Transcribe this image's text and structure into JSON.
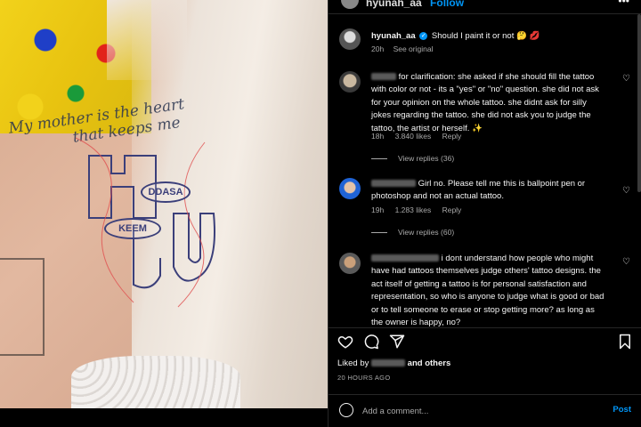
{
  "header": {
    "username": "hyunah_aa",
    "follow_label": "Follow"
  },
  "caption": {
    "username": "hyunah_aa",
    "text": "Should I paint it or not 🤔 💋",
    "time": "20h",
    "see_original": "See original"
  },
  "photo": {
    "tattoo_script_line1": "My mother is the heart",
    "tattoo_script_line2": "that keeps me",
    "oval_1": "DDASA",
    "oval_2": "KEEM"
  },
  "comments": [
    {
      "lines": [
        "for clarification: she asked if she should fill the tattoo",
        "with color or not - its a \"yes\" or \"no\" question. she did not ask",
        "for your opinion on the whole tattoo. she didnt ask for silly",
        "jokes regarding the tattoo. she did not ask you to judge the",
        "tattoo, the artist or herself. ✨"
      ],
      "time": "18h",
      "likes": "3.840 likes",
      "reply": "Reply",
      "view_replies": "View replies (36)"
    },
    {
      "lines": [
        "Girl no. Please tell me this is ballpoint pen or",
        "photoshop and not an actual tattoo."
      ],
      "time": "19h",
      "likes": "1.283 likes",
      "reply": "Reply",
      "view_replies": "View replies (60)"
    },
    {
      "lines": [
        "i dont understand how people who might",
        "have had tattoos themselves judge others' tattoo designs. the",
        "act itself of getting a tattoo is for personal satisfaction and",
        "representation, so who is anyone to judge what is good or bad",
        "or to tell someone to erase or stop getting more? as long as",
        "the owner is happy, no?"
      ]
    }
  ],
  "actions": {
    "liked_by_prefix": "Liked by",
    "liked_by_suffix": "and others",
    "date": "20 HOURS AGO"
  },
  "add_comment": {
    "placeholder": "Add a comment...",
    "post_label": "Post"
  },
  "icons": {
    "heart": "heart-icon",
    "comment": "comment-icon",
    "share": "share-icon",
    "save": "bookmark-icon",
    "emoji": "emoji-icon",
    "verified": "verified-badge-icon"
  },
  "colors": {
    "accent": "#0095f6",
    "background": "#000000",
    "muted": "#a8a8a8"
  }
}
